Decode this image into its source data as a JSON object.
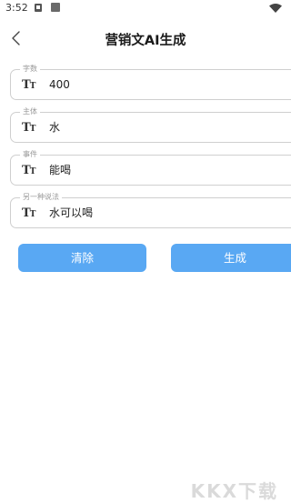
{
  "status_bar": {
    "time": "3:52",
    "icons": [
      "notification-icon",
      "square-icon",
      "wifi-icon"
    ]
  },
  "header": {
    "title": "营销文AI生成",
    "back_icon": "chevron-left-icon"
  },
  "form": {
    "fields": [
      {
        "label": "字数",
        "value": "400",
        "icon": "text-size-icon"
      },
      {
        "label": "主体",
        "value": "水",
        "icon": "text-size-icon"
      },
      {
        "label": "事件",
        "value": "能喝",
        "icon": "text-size-icon"
      },
      {
        "label": "另一种说法",
        "value": "水可以喝",
        "icon": "text-size-icon"
      }
    ]
  },
  "buttons": {
    "clear_label": "清除",
    "generate_label": "生成",
    "color": "#59a8f3"
  },
  "watermark": "KKX下载"
}
